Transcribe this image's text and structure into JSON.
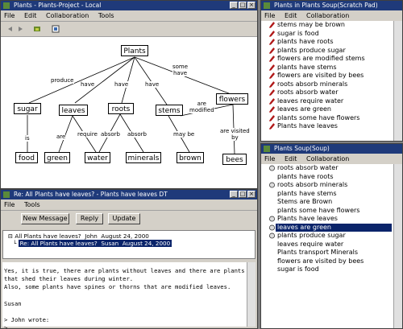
{
  "main_window": {
    "title": "Plants - Plants-Project - Local",
    "menu": [
      "File",
      "Edit",
      "Collaboration",
      "Tools"
    ]
  },
  "concept_map": {
    "nodes": {
      "plants": "Plants",
      "sugar": "sugar",
      "leaves": "leaves",
      "roots": "roots",
      "stems": "stems",
      "flowers": "flowers",
      "food": "food",
      "green": "green",
      "water": "water",
      "minerals": "minerals",
      "brown": "brown",
      "bees": "bees"
    },
    "links": {
      "produce": "produce",
      "have1": "have",
      "have2": "have",
      "have3": "have",
      "some_have": "some\nhave",
      "are": "are",
      "require": "require",
      "absorb1": "absorb",
      "absorb2": "absorb",
      "are_modified": "are\nmodified",
      "is": "is",
      "may_be": "may be",
      "are_visited_by": "are visited\nby"
    }
  },
  "scratch_pad": {
    "title": "Plants in Plants Soup(Scratch Pad)",
    "menu": [
      "File",
      "Edit",
      "Collaboration"
    ],
    "items": [
      "stems may be brown",
      "sugar is food",
      "plants have roots",
      "plants produce sugar",
      "flowers are modified stems",
      "plants have stems",
      "flowers are visited by bees",
      "roots absorb minerals",
      "roots absorb water",
      "leaves require water",
      "leaves are green",
      "plants some have flowers",
      "Plants have leaves"
    ]
  },
  "soup": {
    "title": "Plants Soup(Soup)",
    "menu": [
      "File",
      "Edit",
      "Collaboration"
    ],
    "items": [
      "roots absorb water",
      "plants have roots",
      "roots absorb minerals",
      "plants have stems",
      "Stems are Brown",
      "plants some have flowers",
      "Plants have leaves",
      "leaves are green",
      "plants produce sugar",
      "leaves require water",
      "Plants transport Minerals",
      "flowers are visited by bees",
      "sugar is food"
    ],
    "selected_index": 7
  },
  "message_window": {
    "title": "Re: All Plants have leaves? - Plants have leaves DT",
    "menu": [
      "File",
      "Tools"
    ],
    "buttons": {
      "new_message": "New Message",
      "reply": "Reply",
      "update": "Update"
    },
    "thread": [
      {
        "subject": "All Plants have leaves?",
        "author": "John",
        "date": "August 24, 2000"
      },
      {
        "subject": "Re: All Plants have leaves?",
        "author": "Susan",
        "date": "August 24, 2000"
      }
    ],
    "body": "Yes, it is true, there are plants without leaves and there are plants\nthat shed their leaves during winter.\nAlso, some plants have spines or thorns that are modified leaves.\n\nSusan\n\n> John wrote:\n>\n> Well, do you think all plants have leaves?\n> I live in Arizona and I have seen many plants without leaves.\n>"
  },
  "colors": {
    "title_bar": "#1f3a7a",
    "selection": "#0a246a",
    "chrome": "#d4d0c8"
  }
}
